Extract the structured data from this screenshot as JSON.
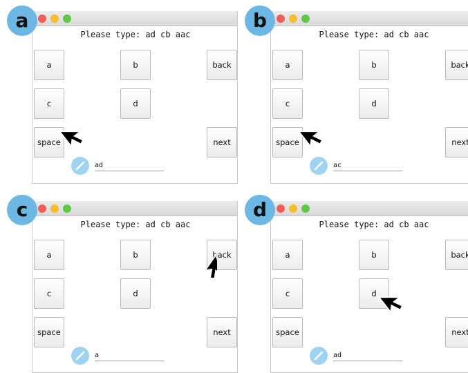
{
  "panels": [
    {
      "badge": "a",
      "prompt": "Please type: ad cb aac",
      "keys": {
        "a": "a",
        "b": "b",
        "back": "back",
        "c": "c",
        "d": "d",
        "space": "space",
        "next": "next"
      },
      "typed_text": "ad",
      "cursor_target": "space key"
    },
    {
      "badge": "b",
      "prompt": "Please type: ad cb aac",
      "keys": {
        "a": "a",
        "b": "b",
        "back": "back",
        "c": "c",
        "d": "d",
        "space": "space",
        "next": "next"
      },
      "typed_text": "ac",
      "cursor_target": "space key"
    },
    {
      "badge": "c",
      "prompt": "Please type: ad cb aac",
      "keys": {
        "a": "a",
        "b": "b",
        "back": "back",
        "c": "c",
        "d": "d",
        "space": "space",
        "next": "next"
      },
      "typed_text": "a",
      "cursor_target": "back key"
    },
    {
      "badge": "d",
      "prompt": "Please type: ad cb aac",
      "keys": {
        "a": "a",
        "b": "b",
        "back": "back",
        "c": "c",
        "d": "d",
        "space": "space",
        "next": "next"
      },
      "typed_text": "ad",
      "cursor_target": "d key"
    }
  ],
  "colors": {
    "badge": "#6cb7e4",
    "pencil_circle": "#9fd3f2",
    "traffic_red": "#ee5f57",
    "traffic_yellow": "#f5bd2f",
    "traffic_green": "#5fc847"
  },
  "icons": [
    "pencil-icon",
    "mouse-pointer-icon"
  ]
}
